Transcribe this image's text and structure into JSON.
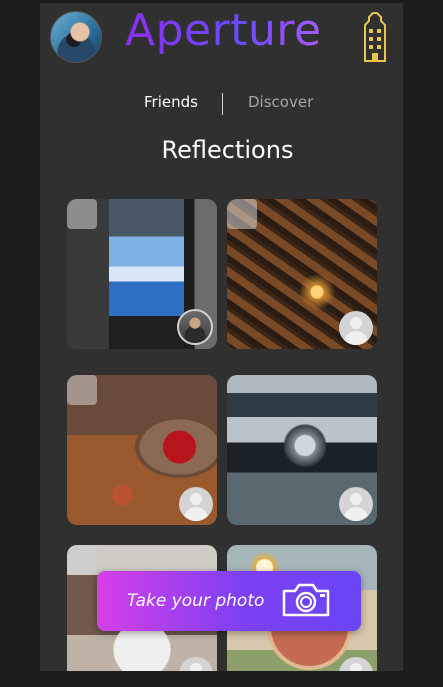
{
  "header": {
    "brand": "Aperture",
    "avatar_icon": "user-avatar-photo",
    "right_icon": "building-icon"
  },
  "tabs": [
    {
      "label": "Friends",
      "active": true
    },
    {
      "label": "Discover",
      "active": false
    }
  ],
  "section": {
    "title": "Reflections"
  },
  "photos": [
    {
      "subject": "street puddle reflection",
      "badge": "user-photo-badge"
    },
    {
      "subject": "street lamp reflection",
      "badge": "default-avatar-badge"
    },
    {
      "subject": "apple in mirror",
      "badge": "default-avatar-badge"
    },
    {
      "subject": "crystal ball on bridge",
      "badge": "default-avatar-badge"
    },
    {
      "subject": "mirror portrait",
      "badge": "default-avatar-badge"
    },
    {
      "subject": "sunglasses flowers",
      "badge": "default-avatar-badge"
    }
  ],
  "cta": {
    "label": "Take your photo",
    "icon": "camera-icon"
  },
  "colors": {
    "background": "#1d1d20",
    "panel": "#303030",
    "brand_gradient_start": "#8a2ff0",
    "brand_gradient_end": "#b25bff",
    "cta_gradient_start": "#d63fe8",
    "cta_gradient_end": "#6a44f6"
  }
}
